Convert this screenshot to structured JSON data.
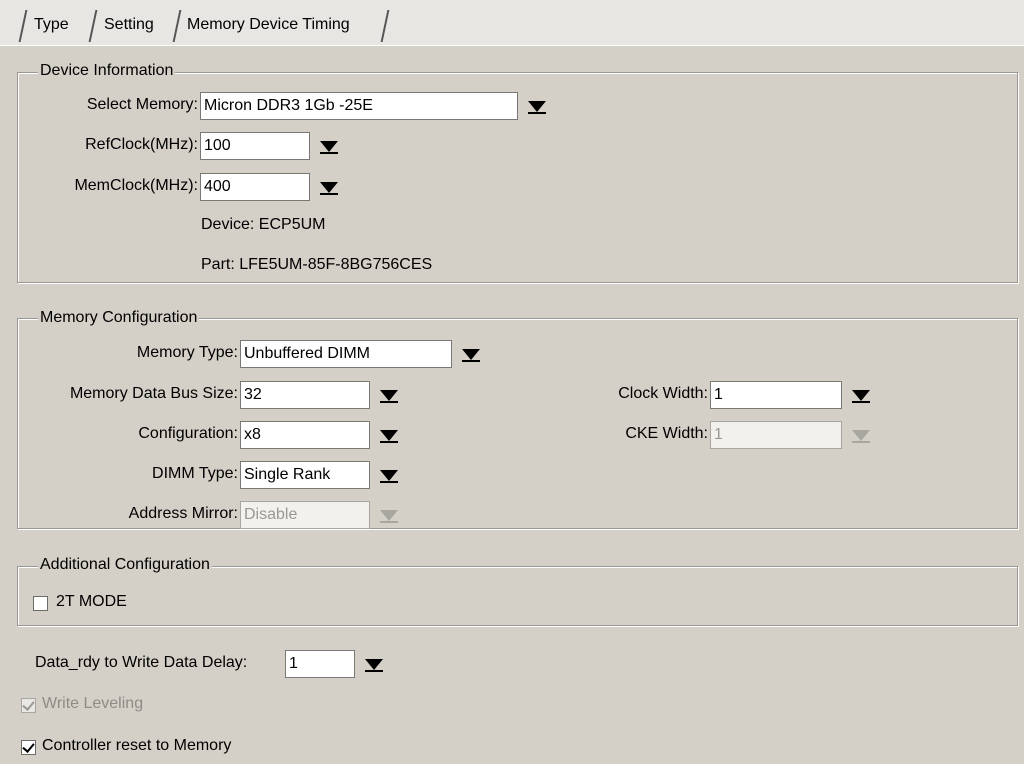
{
  "tabs": [
    {
      "label": "Type"
    },
    {
      "label": "Setting"
    },
    {
      "label": "Memory Device Timing"
    }
  ],
  "device_info": {
    "title": "Device Information",
    "select_memory": {
      "label": "Select Memory:",
      "value": "Micron DDR3 1Gb -25E"
    },
    "refclock": {
      "label": "RefClock(MHz):",
      "value": "100"
    },
    "memclock": {
      "label": "MemClock(MHz):",
      "value": "400"
    },
    "device": "Device: ECP5UM",
    "part": "Part: LFE5UM-85F-8BG756CES"
  },
  "memory_config": {
    "title": "Memory Configuration",
    "memory_type": {
      "label": "Memory Type:",
      "value": "Unbuffered DIMM"
    },
    "data_bus_size": {
      "label": "Memory Data Bus Size:",
      "value": "32"
    },
    "configuration": {
      "label": "Configuration:",
      "value": "x8"
    },
    "dimm_type": {
      "label": "DIMM Type:",
      "value": "Single Rank"
    },
    "address_mirror": {
      "label": "Address Mirror:",
      "value": "Disable"
    },
    "clock_width": {
      "label": "Clock Width:",
      "value": "1"
    },
    "cke_width": {
      "label": "CKE Width:",
      "value": "1"
    }
  },
  "additional_config": {
    "title": "Additional Configuration",
    "two_t_mode": {
      "label": "2T MODE",
      "checked": false
    }
  },
  "data_rdy_delay": {
    "label": "Data_rdy to Write Data Delay:",
    "value": "1"
  },
  "write_leveling": {
    "label": "Write Leveling",
    "checked": true,
    "enabled": false
  },
  "controller_reset": {
    "label": "Controller reset to Memory",
    "checked": true
  }
}
